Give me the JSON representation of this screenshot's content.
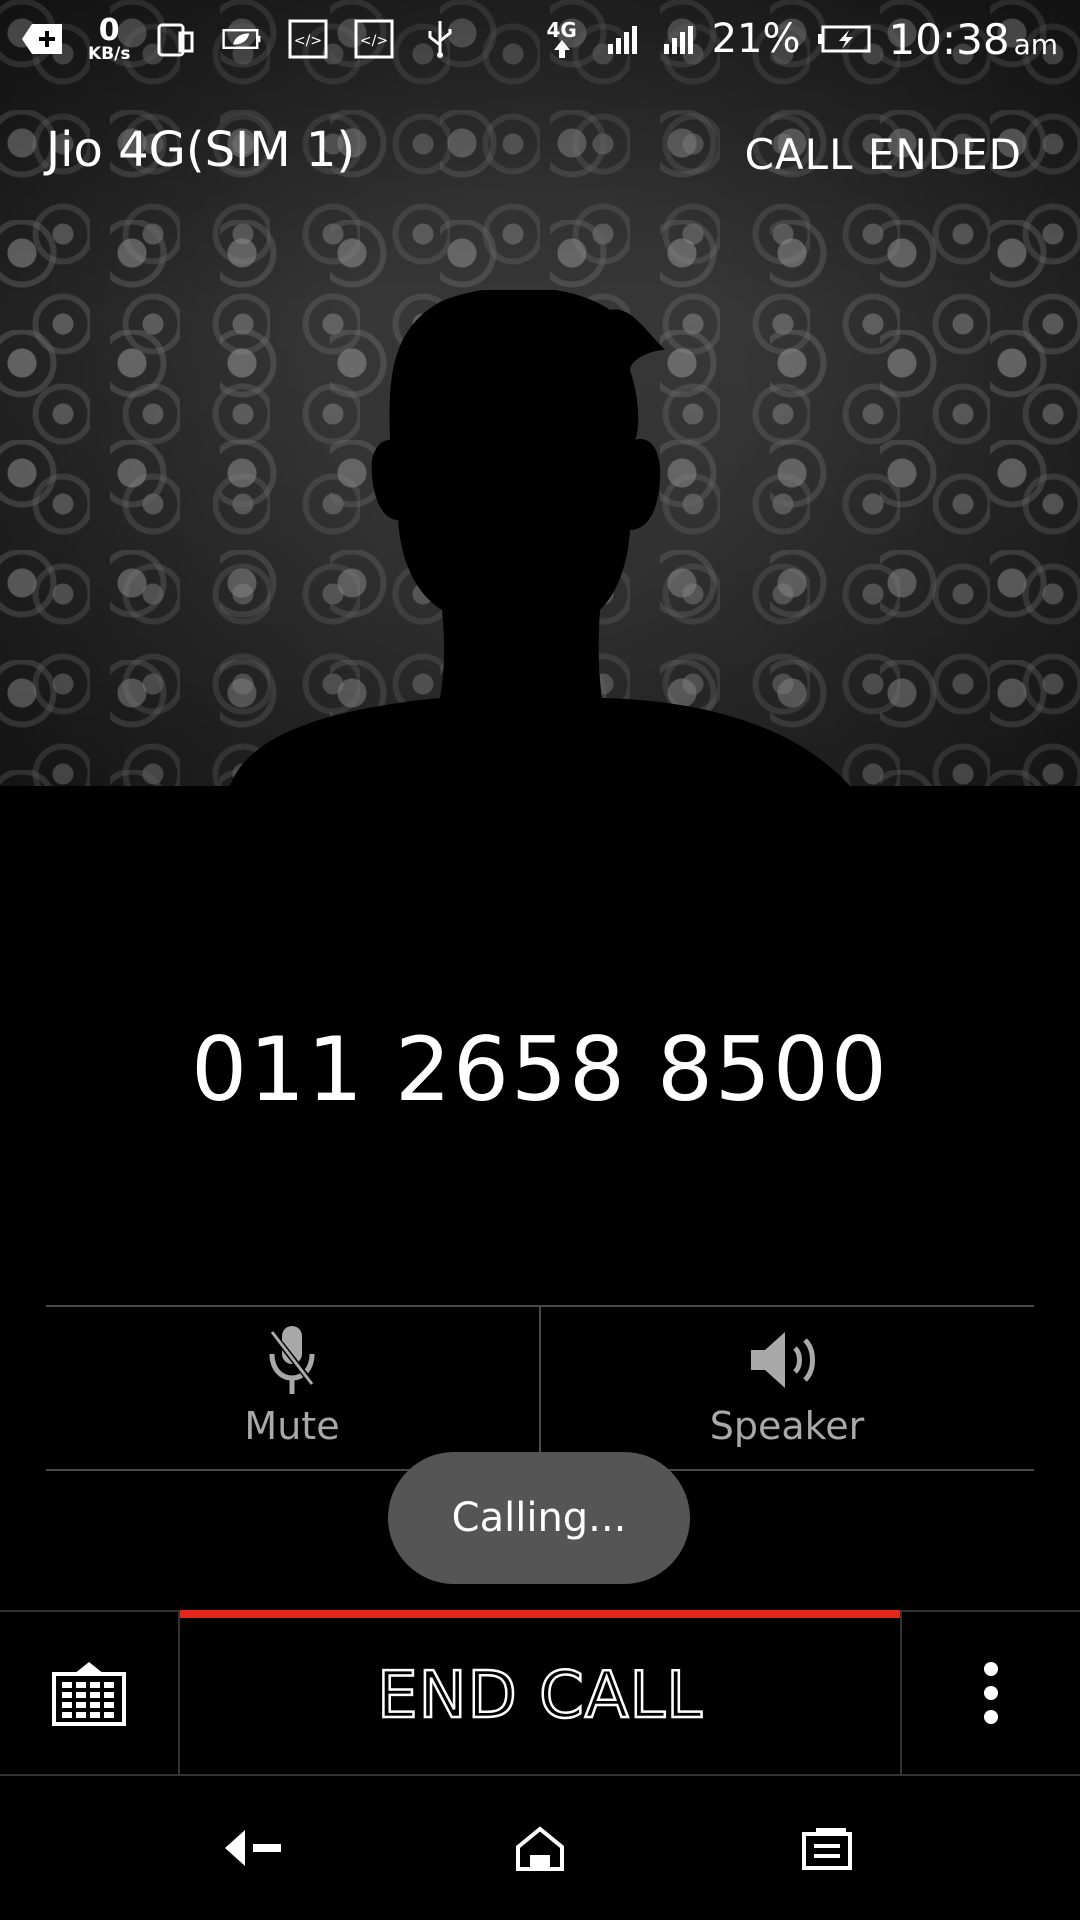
{
  "status_bar": {
    "speed_value": "0",
    "speed_unit": "KB/s",
    "network_type": "4G",
    "battery_percent": "21%",
    "time": "10:38",
    "ampm": "am",
    "icons": [
      "add-icon",
      "phone-screen-icon",
      "battery-saver-icon",
      "code-icon",
      "code-icon",
      "usb-icon",
      "lte-upload-icon",
      "signal-sim1-icon",
      "signal-sim2-icon",
      "battery-charging-icon"
    ]
  },
  "call": {
    "carrier": "Jio 4G(SIM 1)",
    "state": "CALL ENDED",
    "number": "011 2658 8500"
  },
  "controls": {
    "mute_label": "Mute",
    "speaker_label": "Speaker"
  },
  "toast": "Calling...",
  "actions": {
    "end_call_label": "END CALL"
  },
  "colors": {
    "accent_red": "#e5261d",
    "background": "#000000",
    "muted_text": "#a9a9a9",
    "toast_bg": "#555555"
  }
}
